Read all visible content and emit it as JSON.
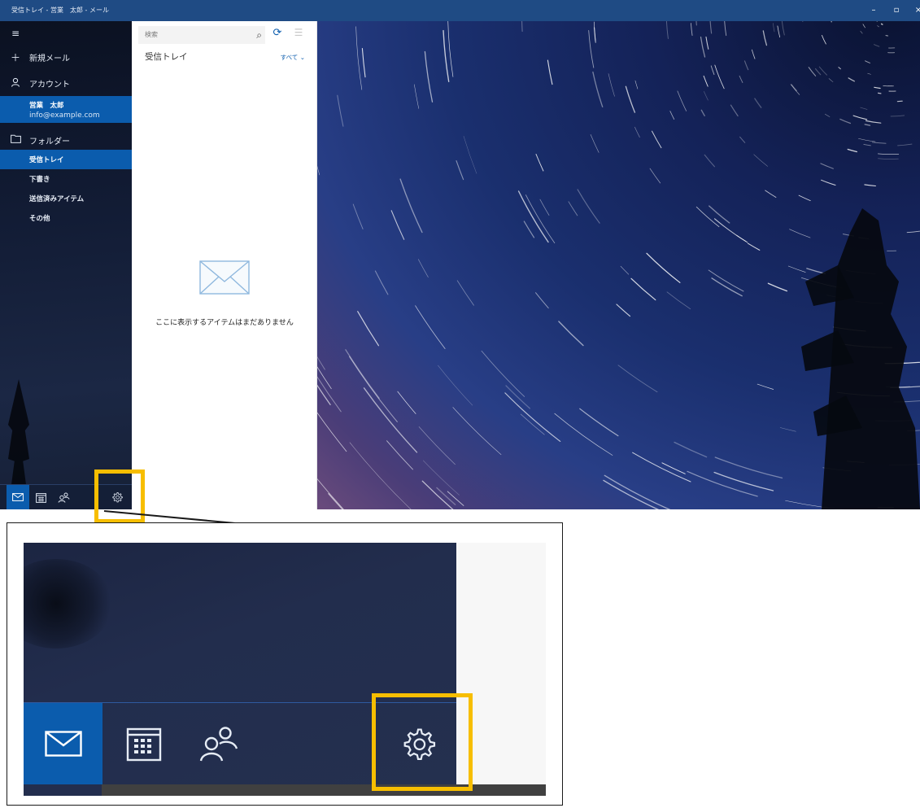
{
  "window": {
    "title": "受信トレイ - 営業　太郎 - メール",
    "controls": {
      "minimize": "–",
      "maximize": "▫",
      "close": "×"
    }
  },
  "nav": {
    "menu_icon": "hamburger-icon",
    "new_mail": "新規メール",
    "accounts_label": "アカウント",
    "account": {
      "name": "営業　太郎",
      "email": "info@example.com"
    },
    "folders_label": "フォルダー",
    "folders": [
      {
        "label": "受信トレイ",
        "selected": true
      },
      {
        "label": "下書き",
        "selected": false
      },
      {
        "label": "送信済みアイテム",
        "selected": false
      },
      {
        "label": "その他",
        "selected": false
      }
    ],
    "bottom_icons": [
      "mail-icon",
      "calendar-icon",
      "people-icon",
      "gear-icon"
    ]
  },
  "list": {
    "search_placeholder": "検索",
    "title": "受信トレイ",
    "filter": "すべて",
    "empty_message": "ここに表示するアイテムはまだありません"
  },
  "colors": {
    "accent": "#0b5cad",
    "titlebar": "#1f4b84",
    "highlight": "#f7be00"
  }
}
